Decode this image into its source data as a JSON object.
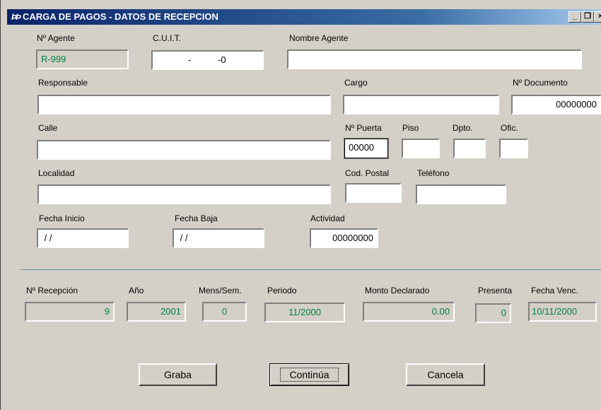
{
  "window": {
    "title": "CARGA DE PAGOS - DATOS DE RECEPCION",
    "icon_name": "app-logo-icon",
    "controls": {
      "minimize": "_",
      "restore": "̈",
      "close": "×"
    }
  },
  "form": {
    "agente": {
      "label": "Nº Agente",
      "value": "R-999"
    },
    "cuit": {
      "label": "C.U.I.T.",
      "value": "  -   -0"
    },
    "nombre_agente": {
      "label": "Nombre  Agente",
      "value": ""
    },
    "responsable": {
      "label": "Responsable",
      "value": ""
    },
    "cargo": {
      "label": "Cargo",
      "value": ""
    },
    "documento": {
      "label": "Nº Documento",
      "value": "00000000"
    },
    "calle": {
      "label": "Calle",
      "value": ""
    },
    "puerta": {
      "label": "Nº Puerta",
      "value": "00000"
    },
    "piso": {
      "label": "Piso",
      "value": ""
    },
    "dpto": {
      "label": "Dpto.",
      "value": ""
    },
    "ofic": {
      "label": "Ofic.",
      "value": ""
    },
    "localidad": {
      "label": "Localidad",
      "value": ""
    },
    "cod_postal": {
      "label": "Cod. Postal",
      "value": ""
    },
    "telefono": {
      "label": "Teléfono",
      "value": ""
    },
    "fecha_inicio": {
      "label": "Fecha Inicio",
      "value": " / /"
    },
    "fecha_baja": {
      "label": "Fecha Baja",
      "value": " / /"
    },
    "actividad": {
      "label": "Actividad",
      "value": "00000000"
    }
  },
  "summary": {
    "recepcion": {
      "label": "Nº Recepción",
      "value": "9"
    },
    "anio": {
      "label": "Año",
      "value": "2001"
    },
    "mens_sem": {
      "label": "Mens/Sem.",
      "value": "0"
    },
    "periodo": {
      "label": "Periodo",
      "value": "11/2000"
    },
    "monto": {
      "label": "Monto Declarado",
      "value": "0.00"
    },
    "presenta": {
      "label": "Presenta",
      "value": "0"
    },
    "fecha_venc": {
      "label": "Fecha Venc.",
      "value": "10/11/2000"
    }
  },
  "buttons": {
    "graba": "Graba",
    "continua": "Continúa",
    "cancela": "Cancela"
  },
  "colors": {
    "titlebar_start": "#0a246a",
    "readonly_text": "#00803c",
    "window_bg": "#d4d0c8"
  }
}
